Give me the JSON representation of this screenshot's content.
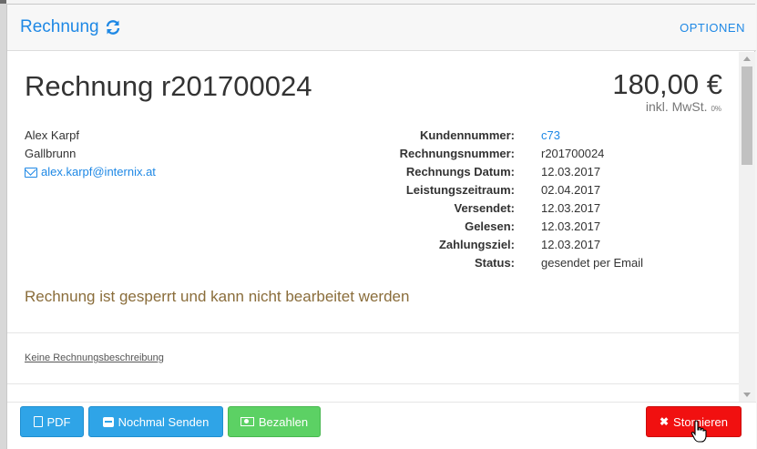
{
  "header": {
    "title": "Rechnung",
    "refresh_icon": "refresh-icon",
    "options_label": "OPTIONEN"
  },
  "invoice": {
    "title": "Rechnung r201700024",
    "amount": "180,00 €",
    "tax_label": "inkl. MwSt.",
    "tax_rate": "0%"
  },
  "customer": {
    "name": "Alex Karpf",
    "city": "Gallbrunn",
    "email": "alex.karpf@internix.at"
  },
  "details": [
    {
      "label": "Kundennummer:",
      "value": "c73"
    },
    {
      "label": "Rechnungsnummer:",
      "value": "r201700024"
    },
    {
      "label": "Rechnungs Datum:",
      "value": "12.03.2017"
    },
    {
      "label": "Leistungszeitraum:",
      "value": "02.04.2017"
    },
    {
      "label": "Versendet:",
      "value": "12.03.2017"
    },
    {
      "label": "Gelesen:",
      "value": "12.03.2017"
    },
    {
      "label": "Zahlungsziel:",
      "value": "12.03.2017"
    },
    {
      "label": "Status:",
      "value": "gesendet per Email"
    }
  ],
  "locked_message": "Rechnung ist gesperrt und kann nicht bearbeitet werden",
  "description_link": "Keine Rechnungsbeschreibung",
  "footer": {
    "pdf_label": "PDF",
    "send_label": "Nochmal Senden",
    "pay_label": "Bezahlen",
    "cancel_label": "Stornieren"
  },
  "colors": {
    "link": "#1e88e5",
    "primary_button": "#2fa4e7",
    "success_button": "#5cd164",
    "danger_button": "#f11010",
    "warning_text": "#8a6d3b"
  }
}
